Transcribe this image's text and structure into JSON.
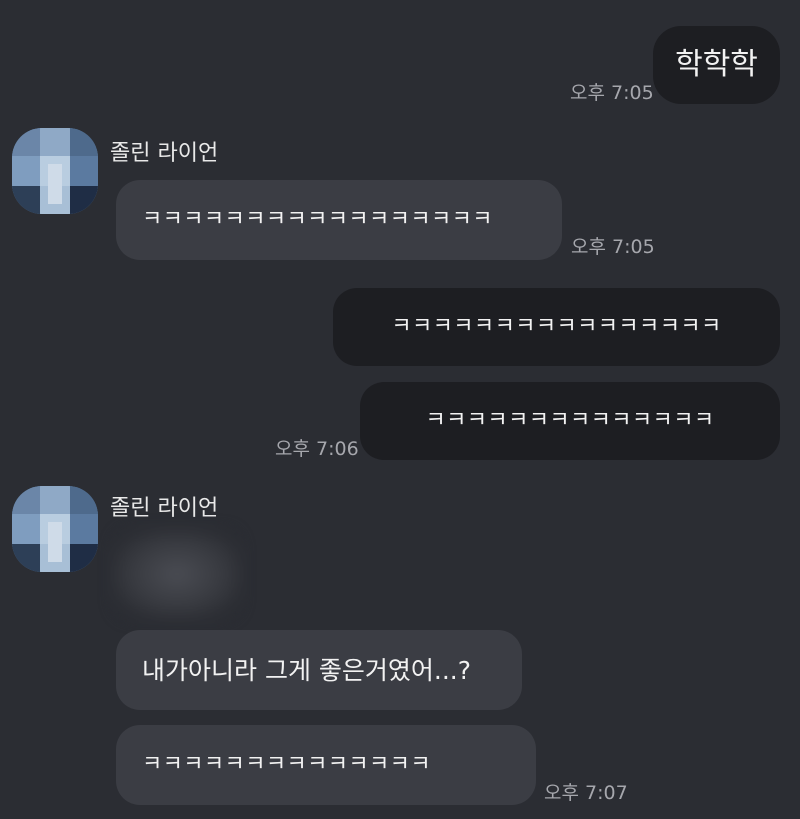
{
  "chat": {
    "messages": [
      {
        "text": "학학학",
        "time": "오후 7:05"
      },
      {
        "sender": "졸린 라이언",
        "text": "ㅋㅋㅋㅋㅋㅋㅋㅋㅋㅋㅋㅋㅋㅋㅋㅋㅋ",
        "time": "오후 7:05"
      },
      {
        "text": "ㅋㅋㅋㅋㅋㅋㅋㅋㅋㅋㅋㅋㅋㅋㅋㅋ"
      },
      {
        "text": "ㅋㅋㅋㅋㅋㅋㅋㅋㅋㅋㅋㅋㅋㅋ",
        "time": "오후 7:06"
      },
      {
        "sender": "졸린 라이언"
      },
      {
        "text": "내가아니라 그게 좋은거였어...?"
      },
      {
        "text": "ㅋㅋㅋㅋㅋㅋㅋㅋㅋㅋㅋㅋㅋㅋ",
        "time": "오후 7:07"
      }
    ]
  },
  "colors": {
    "background": "#2b2d33",
    "outgoing_bubble": "#1d1e22",
    "incoming_bubble": "#3b3d44",
    "timestamp": "#a6a7ad"
  },
  "icons": {
    "avatar": "pixelated-profile-picture"
  }
}
